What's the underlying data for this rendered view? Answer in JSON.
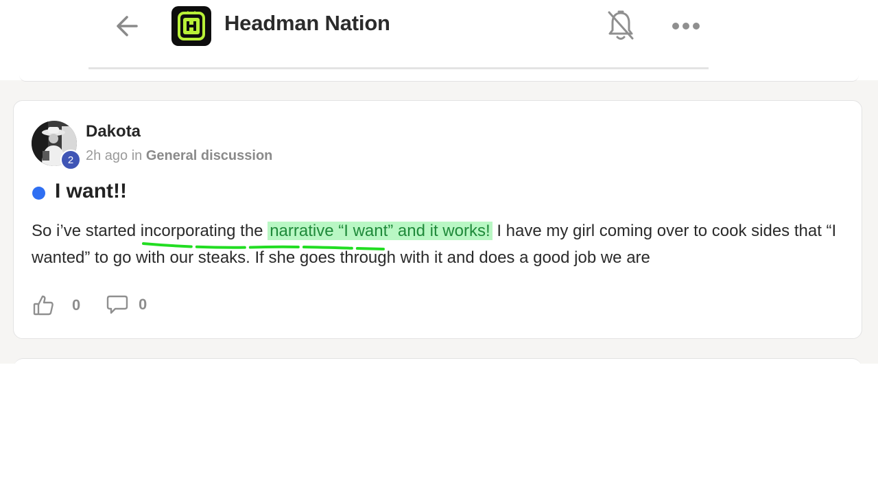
{
  "header": {
    "title": "Headman Nation",
    "back_icon": "arrow-left-icon",
    "logo_icon": "headman-logo-icon",
    "notifications_icon": "bell-off-icon",
    "more_icon": "more-horizontal-icon"
  },
  "post": {
    "author": "Dakota",
    "level": "2",
    "time": "2h ago",
    "in_word": "in",
    "category": "General discussion",
    "title": "I want!!",
    "body_before": "So i’ve started incorporating the ",
    "body_highlight": "narrative “I want” and it works!",
    "body_after": " I have my girl coming over to cook sides that “I wanted” to go with our steaks. If she goes through with it and does a good job we are",
    "likes": "0",
    "comments": "0",
    "like_icon": "thumbs-up-icon",
    "comment_icon": "comment-icon"
  },
  "colors": {
    "unread_dot": "#2f6ff2",
    "level_badge": "#3f55b5",
    "highlight_bg": "#b9f7c4",
    "highlight_text": "#1f8a3a",
    "underline_marker": "#22dd22",
    "logo_accent": "#b8f037"
  }
}
